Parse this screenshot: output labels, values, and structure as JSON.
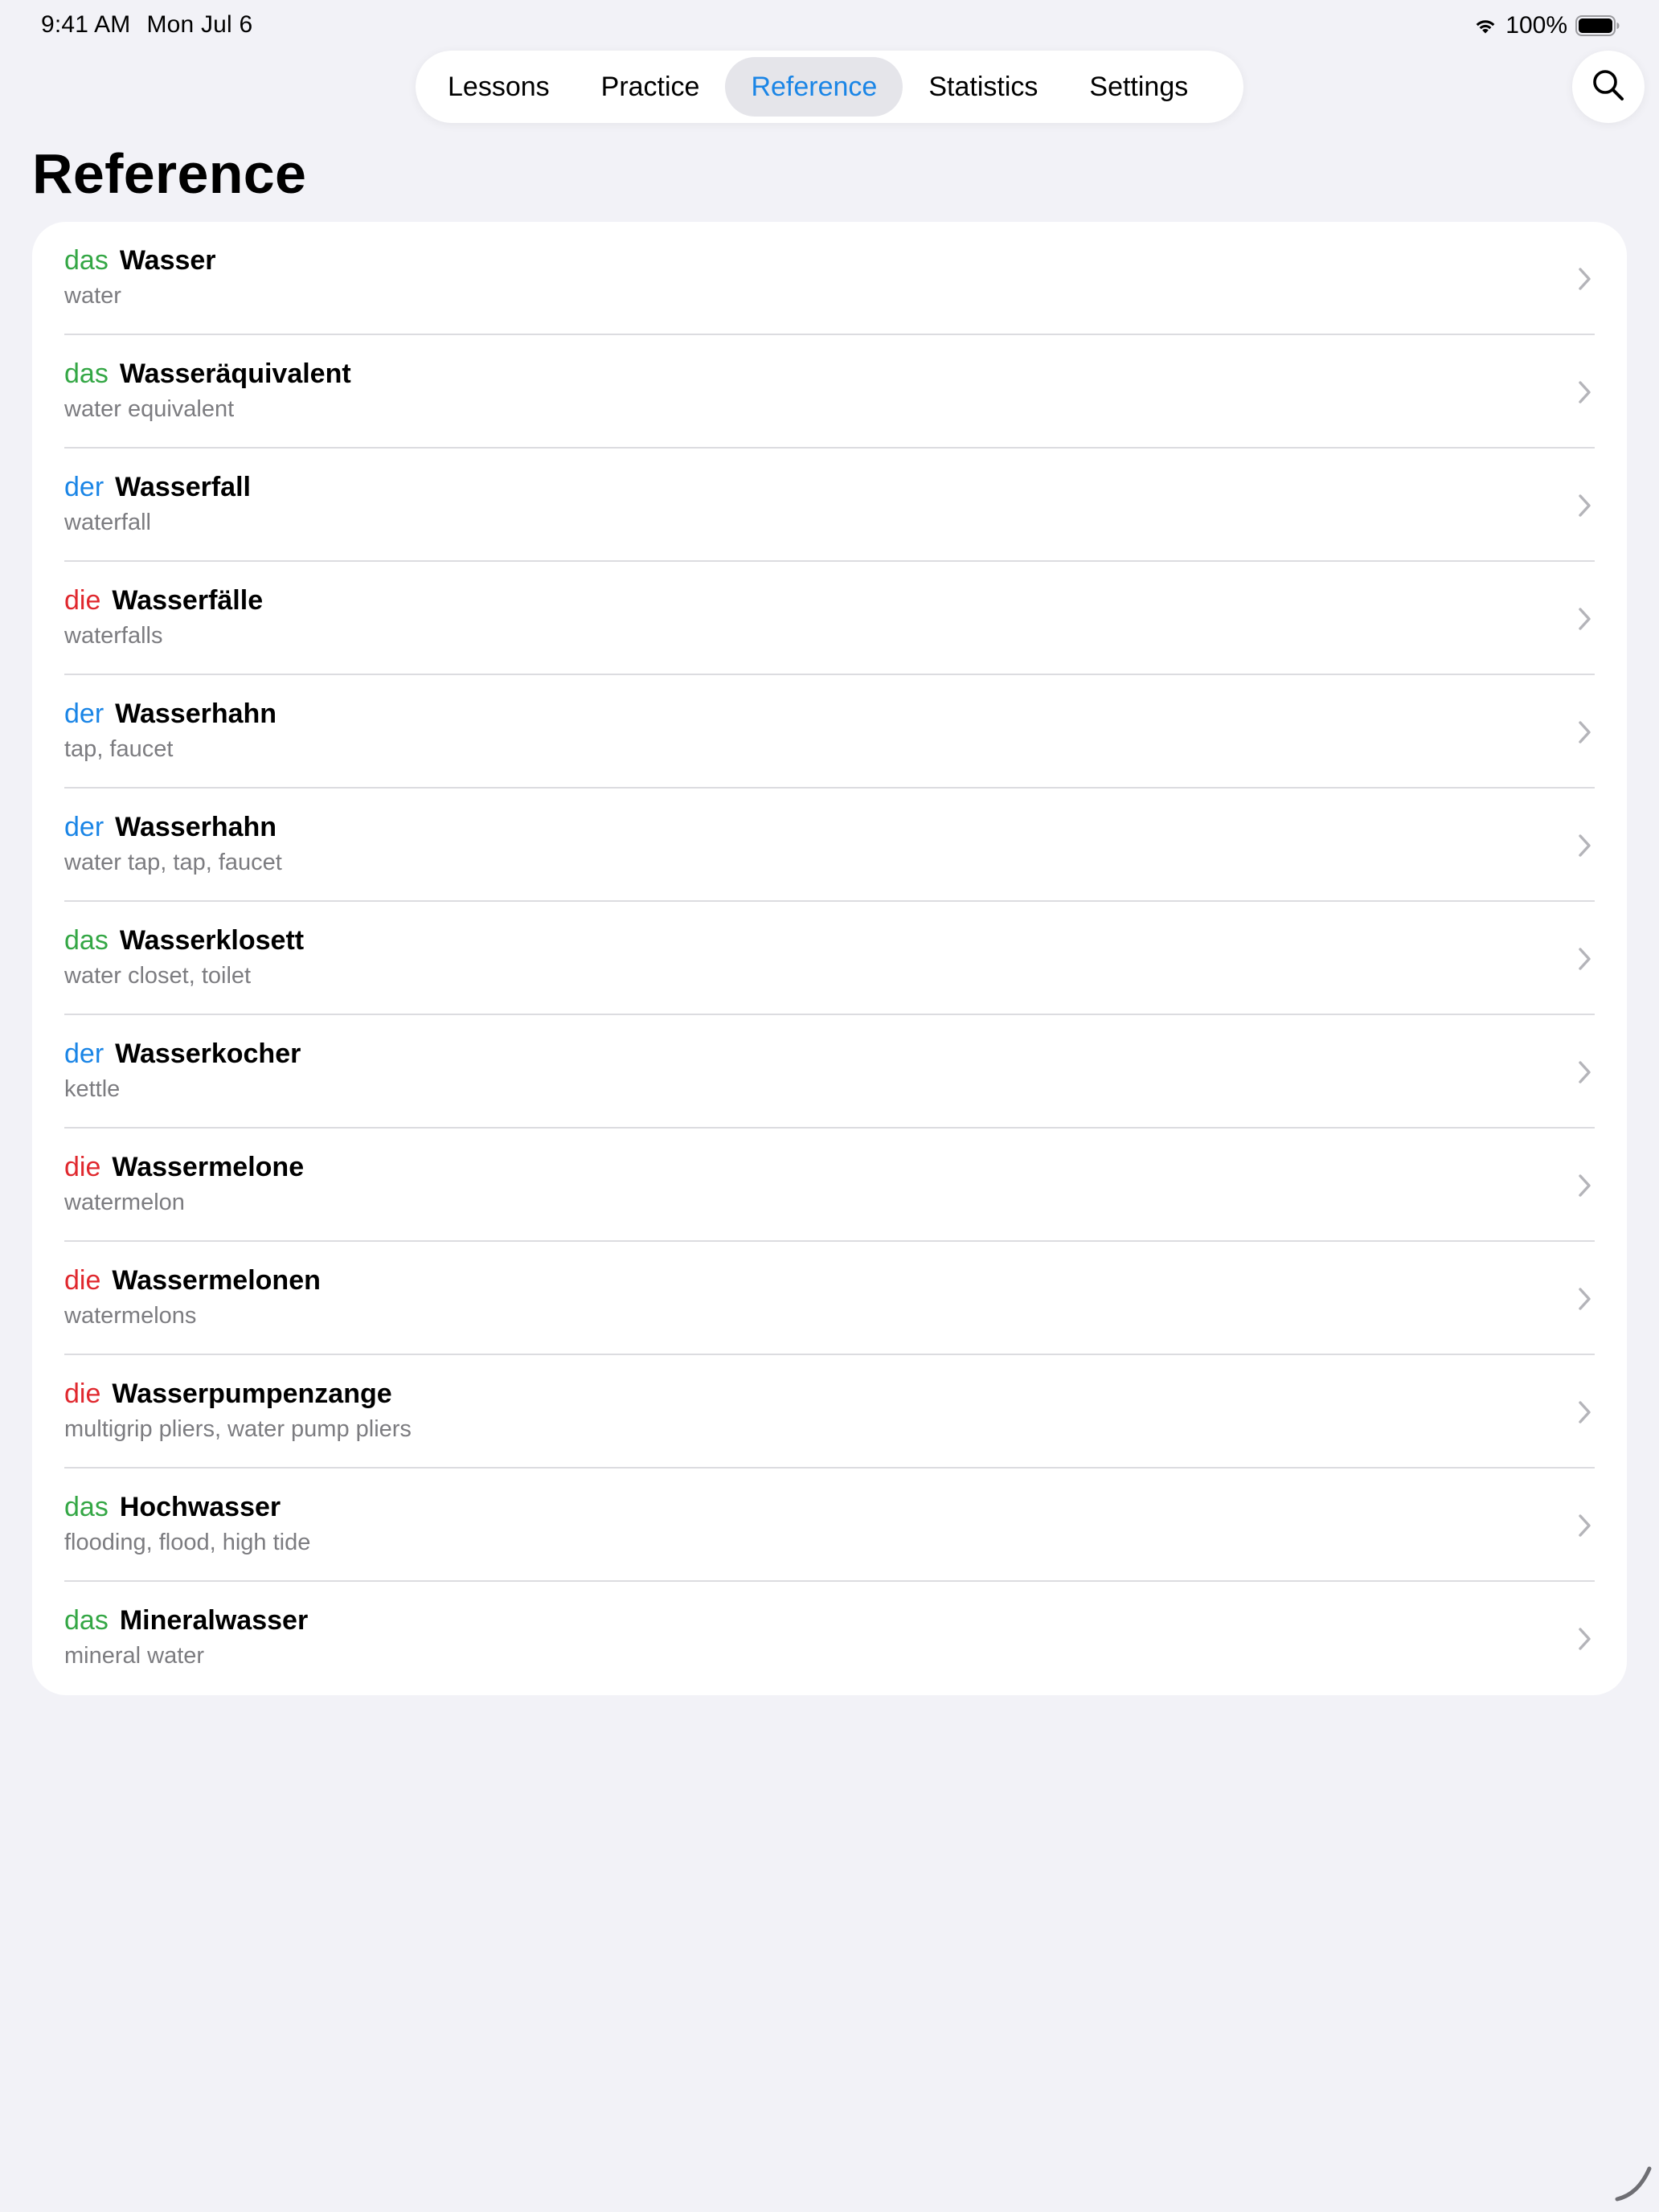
{
  "status_bar": {
    "time": "9:41 AM",
    "date": "Mon Jul 6",
    "battery": "100%",
    "icons": [
      "wifi-icon",
      "battery-icon"
    ]
  },
  "tabs": [
    {
      "label": "Lessons",
      "active": false
    },
    {
      "label": "Practice",
      "active": false
    },
    {
      "label": "Reference",
      "active": true
    },
    {
      "label": "Statistics",
      "active": false
    },
    {
      "label": "Settings",
      "active": false
    }
  ],
  "search_button": {
    "icon": "search-icon"
  },
  "page": {
    "title": "Reference"
  },
  "colors": {
    "das": "#34a745",
    "der": "#1a85e6",
    "die": "#e0282e",
    "accent": "#1a85e6"
  },
  "entries": [
    {
      "article": "das",
      "word": "Wasser",
      "translation": "water"
    },
    {
      "article": "das",
      "word": "Wasseräquivalent",
      "translation": "water equivalent"
    },
    {
      "article": "der",
      "word": "Wasserfall",
      "translation": "waterfall"
    },
    {
      "article": "die",
      "word": "Wasserfälle",
      "translation": "waterfalls"
    },
    {
      "article": "der",
      "word": "Wasserhahn",
      "translation": "tap, faucet"
    },
    {
      "article": "der",
      "word": "Wasserhahn",
      "translation": "water tap, tap, faucet"
    },
    {
      "article": "das",
      "word": "Wasserklosett",
      "translation": "water closet, toilet"
    },
    {
      "article": "der",
      "word": "Wasserkocher",
      "translation": "kettle"
    },
    {
      "article": "die",
      "word": "Wassermelone",
      "translation": "watermelon"
    },
    {
      "article": "die",
      "word": "Wassermelonen",
      "translation": "watermelons"
    },
    {
      "article": "die",
      "word": "Wasserpumpenzange",
      "translation": "multigrip pliers, water pump pliers"
    },
    {
      "article": "das",
      "word": "Hochwasser",
      "translation": "flooding, flood, high tide"
    },
    {
      "article": "das",
      "word": "Mineralwasser",
      "translation": "mineral water"
    }
  ]
}
